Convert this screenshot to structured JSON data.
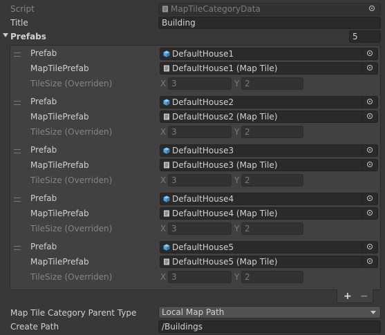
{
  "script": {
    "label": "Script",
    "value": "MapTileCategoryData"
  },
  "title_field": {
    "label": "Title",
    "value": "Building"
  },
  "prefabs": {
    "label": "Prefabs",
    "count": "5",
    "items": [
      {
        "prefab_label": "Prefab",
        "prefab_value": "DefaultHouse1",
        "maptile_label": "MapTilePrefab",
        "maptile_value": "DefaultHouse1 (Map Tile)",
        "tilesize_label": "TileSize (Overriden)",
        "x_label": "X",
        "x_value": "3",
        "y_label": "Y",
        "y_value": "2"
      },
      {
        "prefab_label": "Prefab",
        "prefab_value": "DefaultHouse2",
        "maptile_label": "MapTilePrefab",
        "maptile_value": "DefaultHouse2 (Map Tile)",
        "tilesize_label": "TileSize (Overriden)",
        "x_label": "X",
        "x_value": "3",
        "y_label": "Y",
        "y_value": "2"
      },
      {
        "prefab_label": "Prefab",
        "prefab_value": "DefaultHouse3",
        "maptile_label": "MapTilePrefab",
        "maptile_value": "DefaultHouse3 (Map Tile)",
        "tilesize_label": "TileSize (Overriden)",
        "x_label": "X",
        "x_value": "3",
        "y_label": "Y",
        "y_value": "2"
      },
      {
        "prefab_label": "Prefab",
        "prefab_value": "DefaultHouse4",
        "maptile_label": "MapTilePrefab",
        "maptile_value": "DefaultHouse4 (Map Tile)",
        "tilesize_label": "TileSize (Overriden)",
        "x_label": "X",
        "x_value": "3",
        "y_label": "Y",
        "y_value": "2"
      },
      {
        "prefab_label": "Prefab",
        "prefab_value": "DefaultHouse5",
        "maptile_label": "MapTilePrefab",
        "maptile_value": "DefaultHouse5 (Map Tile)",
        "tilesize_label": "TileSize (Overriden)",
        "x_label": "X",
        "x_value": "3",
        "y_label": "Y",
        "y_value": "2"
      }
    ],
    "add_glyph": "+",
    "remove_glyph": "−"
  },
  "parent_type": {
    "label": "Map Tile Category Parent Type",
    "value": "Local Map Path"
  },
  "create_path": {
    "label": "Create Path",
    "value": "/Buildings"
  },
  "icons": {
    "script": "script-asset-icon",
    "prefab": "prefab-cube-icon",
    "maptile": "script-asset-icon",
    "picker": "object-picker-icon"
  },
  "colors": {
    "background": "#383838",
    "field": "#2a2a2a",
    "prefab_icon": "#4fa3e0",
    "text": "#d2d2d2",
    "dim_text": "#858585"
  }
}
